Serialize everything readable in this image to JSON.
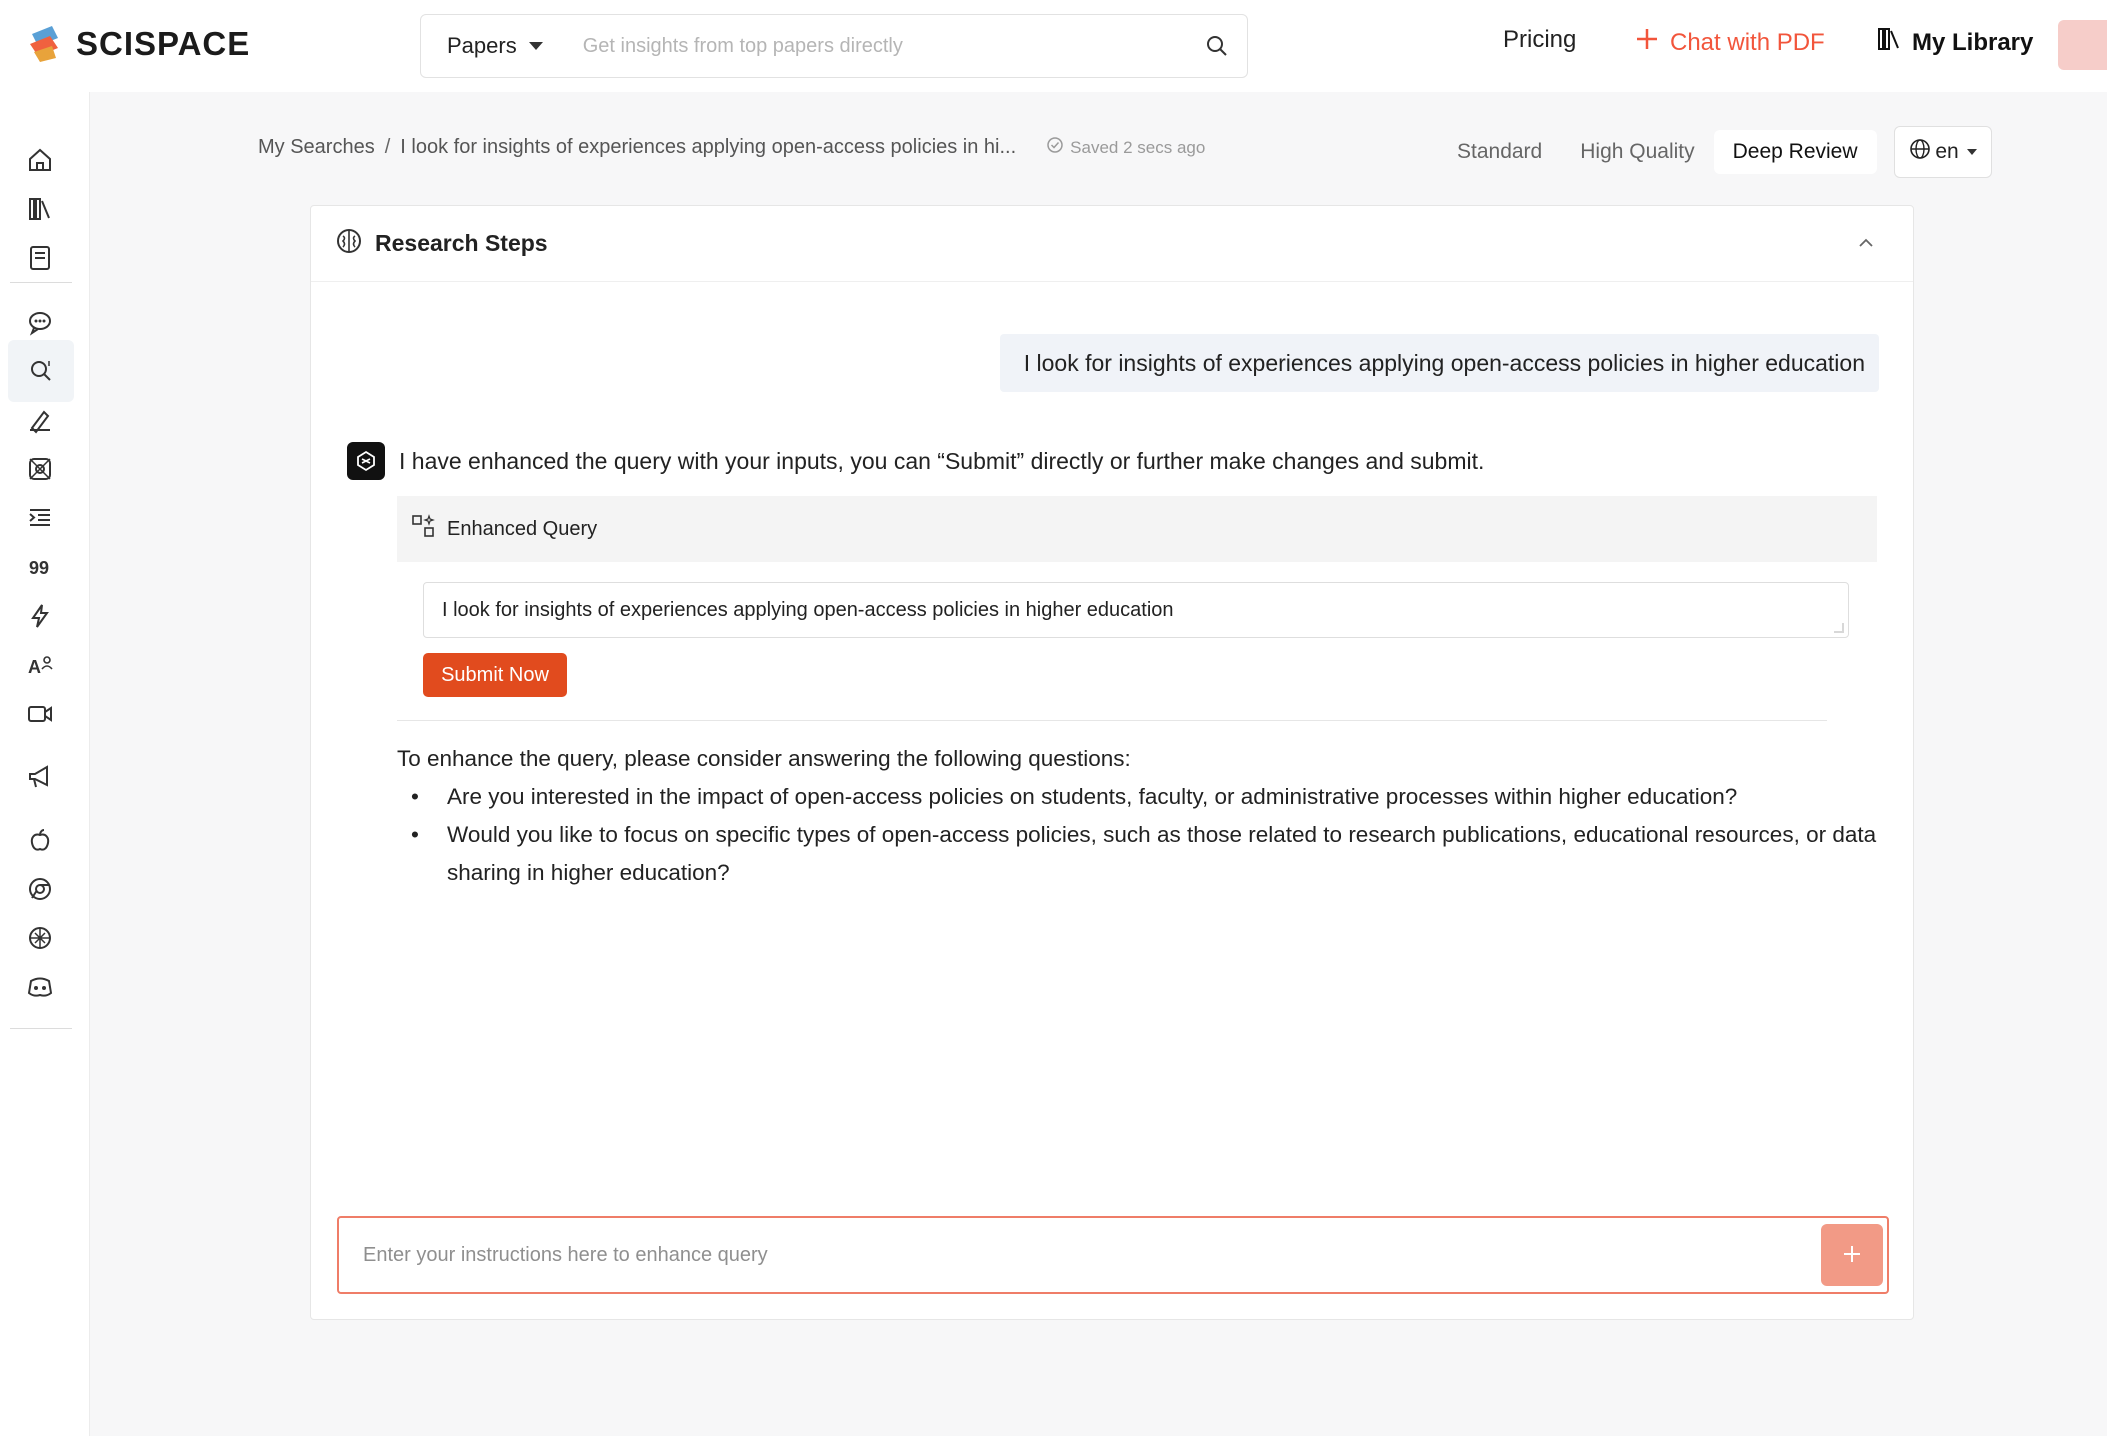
{
  "header": {
    "logo_text": "SCISPACE",
    "search": {
      "type_label": "Papers",
      "placeholder": "Get insights from top papers directly"
    },
    "pricing_label": "Pricing",
    "chat_pdf_label": "Chat with PDF",
    "my_library_label": "My Library",
    "brand_color": "#f2553b"
  },
  "sidebar": {
    "items": [
      {
        "icon": "home-icon"
      },
      {
        "icon": "library-icon"
      },
      {
        "icon": "notebook-icon"
      },
      {
        "icon": "chat-icon"
      },
      {
        "icon": "literature-search-icon",
        "active": true
      },
      {
        "icon": "ai-writer-icon"
      },
      {
        "icon": "extract-data-icon"
      },
      {
        "icon": "outline-icon"
      },
      {
        "icon": "citation-icon"
      },
      {
        "icon": "lightning-icon"
      },
      {
        "icon": "ai-detector-icon"
      },
      {
        "icon": "video-icon"
      },
      {
        "icon": "announcement-icon"
      },
      {
        "icon": "apple-icon"
      },
      {
        "icon": "chrome-icon"
      },
      {
        "icon": "openai-icon"
      },
      {
        "icon": "discord-icon"
      }
    ]
  },
  "breadcrumb": {
    "root": "My Searches",
    "separator": "/",
    "current": "I look for insights of experiences applying open-access policies in hi...",
    "saved_status": "Saved 2 secs ago"
  },
  "modes": {
    "standard": "Standard",
    "high_quality": "High Quality",
    "deep_review": "Deep Review",
    "active": "Deep Review"
  },
  "language": "en",
  "card": {
    "title": "Research Steps",
    "user_message": "I look for insights of experiences applying open-access policies in higher education",
    "bot_message": "I have enhanced the query with your inputs, you can “Submit” directly or further make changes and submit.",
    "enhanced_query": {
      "label": "Enhanced Query",
      "value": "I look for insights of experiences applying open-access policies in higher education",
      "submit_label": "Submit Now"
    },
    "questions_intro": "To enhance the query, please consider answering the following questions:",
    "questions": [
      "Are you interested in the impact of open-access policies on students, faculty, or administrative processes within higher education?",
      "Would you like to focus on specific types of open-access policies, such as those related to research publications, educational resources, or data sharing in higher education?"
    ],
    "instruction_placeholder": "Enter your instructions here to enhance query"
  }
}
